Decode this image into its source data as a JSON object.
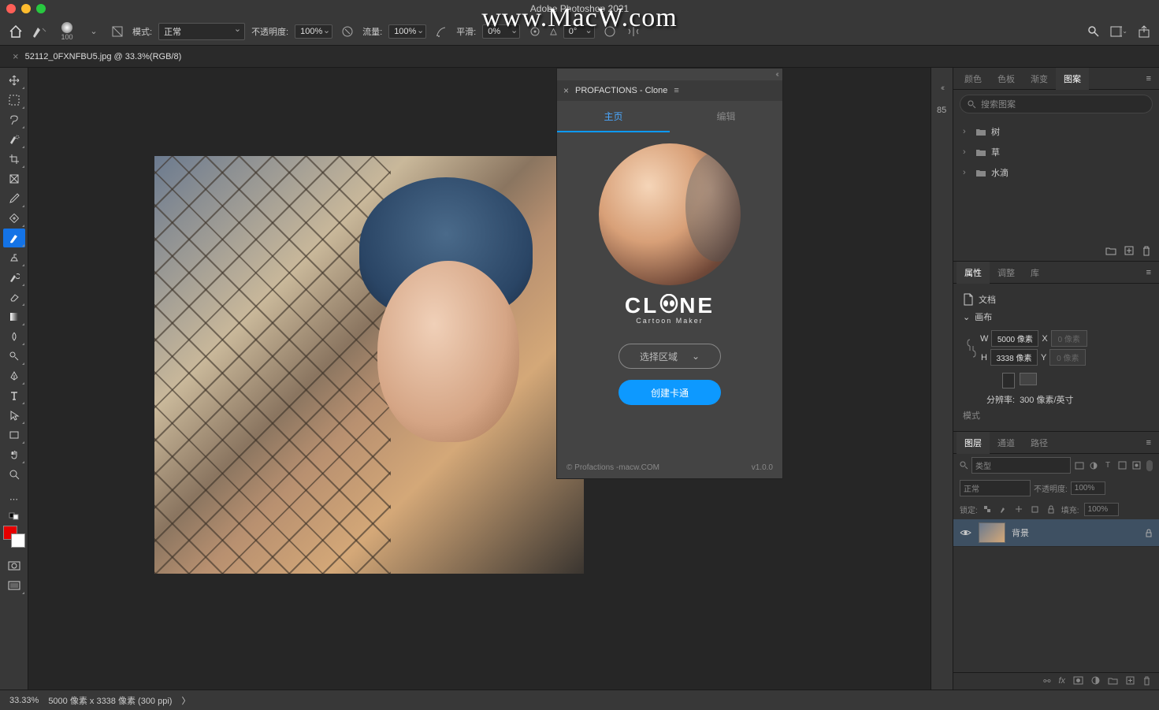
{
  "app": {
    "title": "Adobe Photoshop 2021",
    "watermark": "www.MacW.com"
  },
  "document": {
    "tab_name": "52112_0FXNFBU5.jpg @ 33.3%(RGB/8)"
  },
  "options_bar": {
    "brush_size": "100",
    "mode_label": "模式:",
    "mode_value": "正常",
    "opacity_label": "不透明度:",
    "opacity_value": "100%",
    "flow_label": "流量:",
    "flow_value": "100%",
    "smoothing_label": "平滑:",
    "smoothing_value": "0%",
    "angle_label": "△",
    "angle_value": "0°"
  },
  "tools": [
    "move",
    "marquee",
    "lasso",
    "quick-select",
    "crop",
    "frame",
    "eyedropper",
    "healing",
    "brush",
    "clone-stamp",
    "history-brush",
    "eraser",
    "gradient",
    "blur",
    "dodge",
    "pen",
    "type",
    "path-select",
    "rectangle",
    "hand",
    "zoom"
  ],
  "right": {
    "patterns": {
      "tabs": [
        "颜色",
        "色板",
        "渐变",
        "图案"
      ],
      "active_tab": "图案",
      "search_placeholder": "搜索图案",
      "folders": [
        "树",
        "草",
        "水滴"
      ]
    },
    "properties": {
      "tabs": [
        "属性",
        "调整",
        "库"
      ],
      "active_tab": "属性",
      "doc_label": "文档",
      "canvas_label": "画布",
      "w_label": "W",
      "w_value": "5000 像素",
      "x_label": "X",
      "x_value": "0 像素",
      "h_label": "H",
      "h_value": "3338 像素",
      "y_label": "Y",
      "y_value": "0 像素",
      "resolution_label": "分辨率:",
      "resolution_value": "300 像素/英寸",
      "mode_label": "模式"
    },
    "layers": {
      "tabs": [
        "图层",
        "通道",
        "路径"
      ],
      "active_tab": "图层",
      "filter_label": "类型",
      "blend_mode": "正常",
      "opacity_label": "不透明度:",
      "opacity_value": "100%",
      "lock_label": "锁定:",
      "fill_label": "填充:",
      "fill_value": "100%",
      "layer_name": "背景"
    }
  },
  "plugin": {
    "title": "PROFACTIONS - Clone",
    "tab_home": "主页",
    "tab_edit": "编辑",
    "logo": "CL   NE",
    "logo_sub": "Cartoon Maker",
    "select_area": "选择区域",
    "create_btn": "创建卡通",
    "copyright": "© Profactions -macw.COM",
    "version": "v1.0.0"
  },
  "status": {
    "zoom": "33.33%",
    "dims": "5000 像素 x 3338 像素 (300 ppi)",
    "arrow": "〉"
  }
}
